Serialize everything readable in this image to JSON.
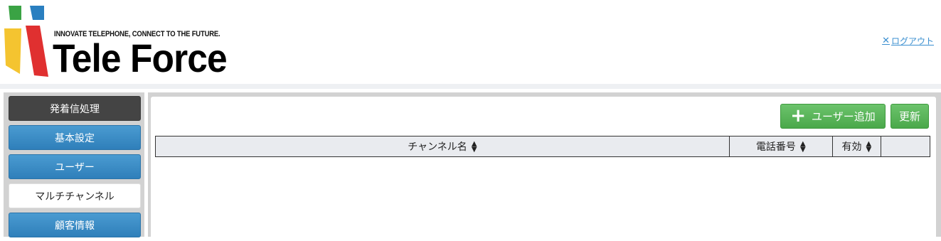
{
  "header": {
    "tagline": "INNOVATE TELEPHONE, CONNECT TO THE FUTURE.",
    "brand": "Tele Force",
    "logout_label": "ログアウト",
    "logout_icon": "close-icon"
  },
  "sidebar": {
    "items": [
      {
        "label": "発着信処理",
        "style": "dark"
      },
      {
        "label": "基本設定",
        "style": "blue"
      },
      {
        "label": "ユーザー",
        "style": "blue"
      },
      {
        "label": "マルチチャンネル",
        "style": "active"
      },
      {
        "label": "顧客情報",
        "style": "blue"
      }
    ]
  },
  "toolbar": {
    "add_user_label": "ユーザー追加",
    "add_user_icon": "plus-icon",
    "refresh_label": "更新"
  },
  "table": {
    "columns": [
      {
        "label": "チャンネル名",
        "sortable": true
      },
      {
        "label": "電話番号",
        "sortable": true
      },
      {
        "label": "有効",
        "sortable": true
      },
      {
        "label": "",
        "sortable": false
      }
    ],
    "rows": []
  },
  "colors": {
    "accent_blue": "#3a8fd0",
    "button_green": "#5cb85c",
    "nav_dark": "#444444",
    "logo_green": "#3aa344",
    "logo_blue": "#2a7fc0",
    "logo_yellow": "#f4c430",
    "logo_red": "#e03030"
  }
}
